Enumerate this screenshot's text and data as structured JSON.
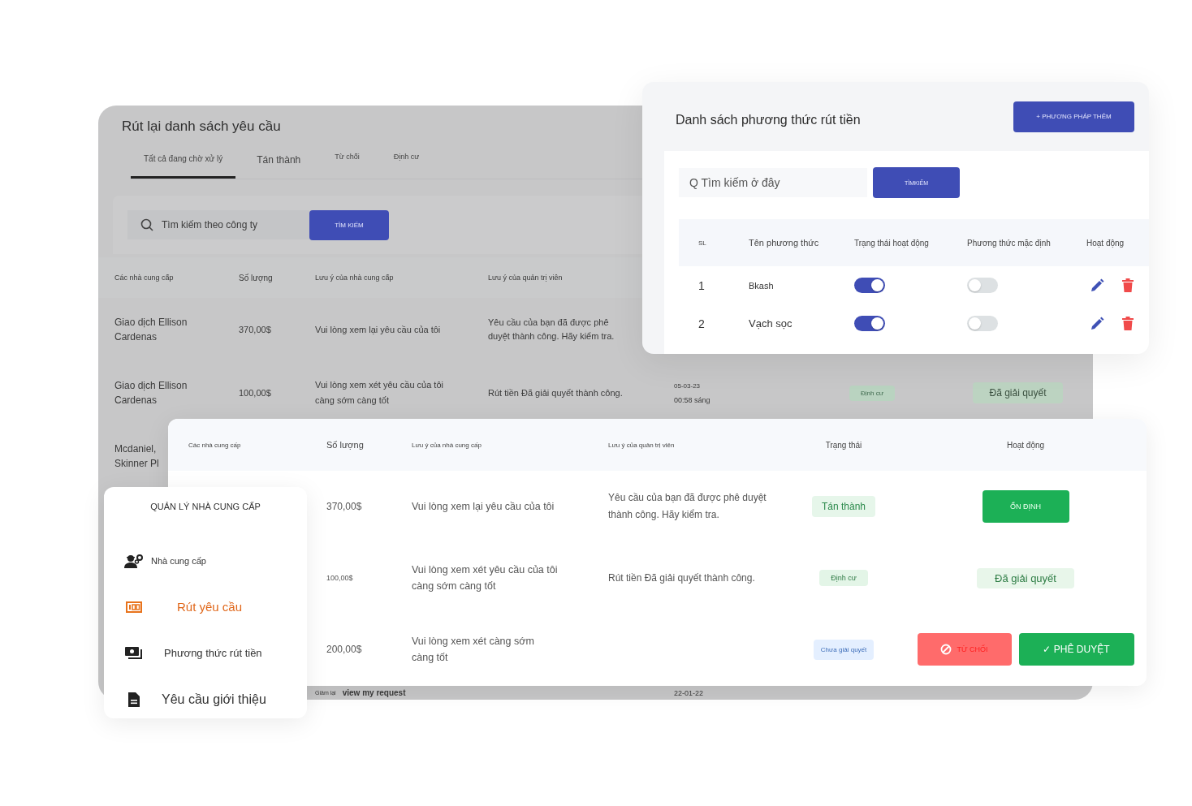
{
  "requests_card": {
    "title": "Rút lại danh sách yêu cầu",
    "tabs": [
      {
        "label": "Tất cả đang chờ xử lý",
        "selected": true
      },
      {
        "label": "Tán thành",
        "selected": false
      },
      {
        "label": "Từ chối",
        "selected": false
      },
      {
        "label": "Định cư",
        "selected": false
      }
    ],
    "search": {
      "placeholder": "Tìm kiếm theo công ty",
      "button": "TÌM KIẾM"
    },
    "columns": [
      "Các nhà cung cấp",
      "Số lượng",
      "Lưu ý của nhà cung cấp",
      "Lưu ý của quản trị viên"
    ],
    "rows": [
      {
        "provider": "Giao dịch Ellison Cardenas",
        "amount": "370,00$",
        "provider_note": "Vui lòng xem lại yêu cầu của tôi",
        "admin_note": "Yêu cầu của bạn đã được phê duyệt thành công. Hãy kiểm tra."
      },
      {
        "provider": "Giao dịch Ellison Cardenas",
        "amount": "100,00$",
        "provider_note": "Vui lòng xem xét yêu cầu của tôi càng sớm càng tốt",
        "admin_note": "Rút tiền Đã giải quyết thành công.",
        "date": "05-03-23",
        "time": "00:58 sáng",
        "status": {
          "kind": "settled",
          "label": "Định cư"
        },
        "action": {
          "kind": "resolved",
          "label": "Đã giải quyết"
        }
      },
      {
        "provider": "Mcdaniel, Skinner Pl"
      }
    ],
    "footer": {
      "provider_note": "Giảm lại",
      "subject": "view my request",
      "date": "22-01-22"
    }
  },
  "methods_card": {
    "title": "Danh sách phương thức rút tiền",
    "add_button": "+ PHƯƠNG PHÁP THÊM",
    "search": {
      "placeholder": "Q Tìm kiếm ở đây",
      "button": "TÌMKIẾM"
    },
    "columns": [
      "SL",
      "Tên phương thức",
      "Trạng thái hoạt động",
      "Phương thức mặc định",
      "Hoạt động"
    ],
    "rows": [
      {
        "index": "1",
        "name": "Bkash",
        "active": true,
        "default": false
      },
      {
        "index": "2",
        "name": "Vạch sọc",
        "active": true,
        "default": false
      }
    ]
  },
  "detail_card": {
    "columns": [
      "Các nhà cung cấp",
      "Số lượng",
      "Lưu ý của nhà cung cấp",
      "Lưu ý của quản trị viên",
      "Trạng thái",
      "Hoạt động"
    ],
    "rows": [
      {
        "amount": "370,00$",
        "provider_note": "Vui lòng xem lại yêu cầu của tôi",
        "admin_note": "Yêu cầu của bạn đã được phê duyệt thành công. Hãy kiểm tra.",
        "status": {
          "kind": "approved",
          "label": "Tán thành"
        },
        "actions": [
          {
            "kind": "stable",
            "label": "ỔN ĐỊNH"
          }
        ]
      },
      {
        "amount": "100,00$",
        "provider_note": "Vui lòng xem xét yêu cầu của tôi càng sớm càng tốt",
        "admin_note": "Rút tiền Đã giải quyết thành công.",
        "status": {
          "kind": "settled",
          "label": "Định cư"
        },
        "actions": [
          {
            "kind": "resolved",
            "label": "Đã giải quyết"
          }
        ]
      },
      {
        "amount": "200,00$",
        "provider_note": "Vui lòng xem xét càng sớm càng tốt",
        "status": {
          "kind": "pending",
          "label": "Chưa giải quyết"
        },
        "actions": [
          {
            "kind": "reject",
            "label": "TỪ CHỐI"
          },
          {
            "kind": "approve",
            "label": "✓ PHÊ DUYỆT"
          }
        ]
      }
    ]
  },
  "sidebar": {
    "heading": "QUẢN LÝ NHÀ CUNG CẤP",
    "items": [
      {
        "kind": "workers",
        "label": "Nhà cung cấp",
        "selected": false
      },
      {
        "kind": "banknote",
        "label": "Rút yêu cầu",
        "selected": true
      },
      {
        "kind": "cash",
        "label": "Phương thức rút tiền",
        "selected": false
      },
      {
        "kind": "document",
        "label": "Yêu cầu giới thiệu",
        "selected": false
      }
    ]
  }
}
